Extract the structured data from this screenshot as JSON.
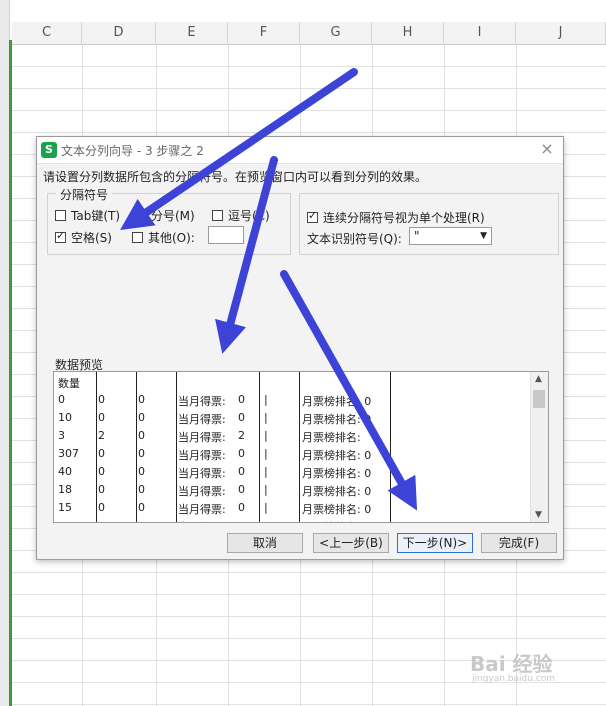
{
  "sheet": {
    "columns": [
      "C",
      "D",
      "E",
      "F",
      "G",
      "H",
      "I",
      "J"
    ]
  },
  "dialog": {
    "app_icon": "S",
    "title": "文本分列向导 - 3 步骤之 2",
    "close_icon": "×",
    "instruction": "请设置分列数据所包含的分隔符号。在预览窗口内可以看到分列的效果。",
    "delimiters_legend": "分隔符号",
    "delimiters": {
      "tab": {
        "label": "Tab键(T)",
        "checked": false
      },
      "semicolon": {
        "label": "分号(M)",
        "checked": false
      },
      "comma": {
        "label": "逗号(C)",
        "checked": false
      },
      "space": {
        "label": "空格(S)",
        "checked": true
      },
      "other": {
        "label": "其他(O):",
        "checked": false,
        "value": ""
      }
    },
    "consecutive": {
      "label": "连续分隔符号视为单个处理(R)",
      "checked": true
    },
    "text_qualifier": {
      "label": "文本识别符号(Q):",
      "value": "\""
    },
    "preview_label": "数据预览",
    "preview_rows": [
      [
        "数量",
        "",
        "",
        "",
        "",
        "",
        ""
      ],
      [
        "0",
        "0",
        "0",
        "当月得票:",
        "0",
        "|",
        "月票榜排名: 0"
      ],
      [
        "10",
        "0",
        "0",
        "当月得票:",
        "0",
        "|",
        "月票榜排名: 0"
      ],
      [
        "3",
        "2",
        "0",
        "当月得票:",
        "2",
        "|",
        "月票榜排名:"
      ],
      [
        "307",
        "0",
        "0",
        "当月得票:",
        "0",
        "|",
        "月票榜排名: 0"
      ],
      [
        "40",
        "0",
        "0",
        "当月得票:",
        "0",
        "|",
        "月票榜排名: 0"
      ],
      [
        "18",
        "0",
        "0",
        "当月得票:",
        "0",
        "|",
        "月票榜排名: 0"
      ],
      [
        "15",
        "0",
        "0",
        "当月得票:",
        "0",
        "|",
        "月票榜排名: 0"
      ],
      [
        "",
        "",
        "",
        "当月得票:",
        "",
        "",
        "月票榜排名:"
      ]
    ],
    "buttons": {
      "cancel": "取消",
      "back": "<上一步(B)",
      "next": "下一步(N)>",
      "finish": "完成(F)"
    }
  },
  "watermark": {
    "main": "Bai 经验",
    "sub": "jingyan.baidu.com"
  },
  "colors": {
    "arrow": "#3d43d6",
    "sheet_green": "#3b9a3b",
    "app_icon": "#1aa34a"
  }
}
